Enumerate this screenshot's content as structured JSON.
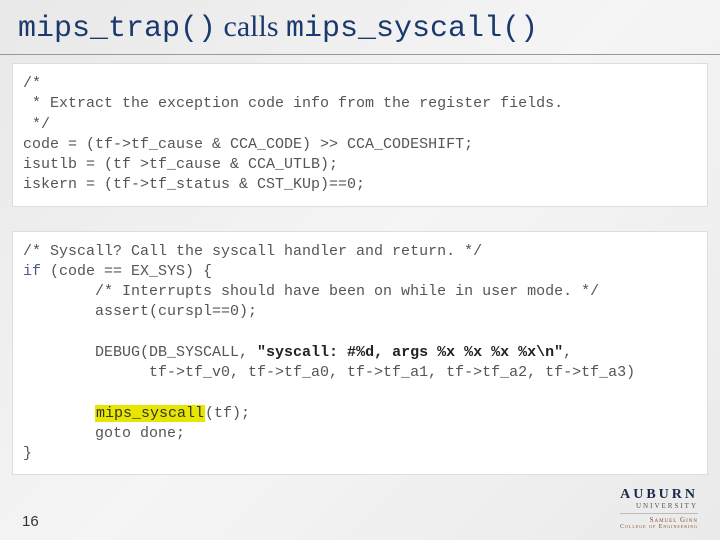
{
  "title": {
    "part1": "mips_trap()",
    "part2": " calls ",
    "part3": "mips_syscall()"
  },
  "code1": {
    "l1": "/*",
    "l2": " * Extract the exception code info from the register fields.",
    "l3": " */",
    "l4": "code = (tf->tf_cause & CCA_CODE) >> CCA_CODESHIFT;",
    "l5": "isutlb = (tf >tf_cause & CCA_UTLB);",
    "l6": "iskern = (tf->tf_status & CST_KUp)==0;"
  },
  "code2": {
    "l1": "/* Syscall? Call the syscall handler and return. */",
    "kw_if": "if",
    "l2b": " (code == EX_SYS) {",
    "l3": "        /* Interrupts should have been on while in user mode. */",
    "l4": "        assert(curspl==0);",
    "l5a": "        DEBUG(DB_SYSCALL, ",
    "l5s": "\"syscall: #%d, args %x %x %x %x\\n\"",
    "l5b": ",",
    "l6": "              tf->tf_v0, tf->tf_a0, tf->tf_a1, tf->tf_a2, tf->tf_a3)",
    "l7h": "mips_syscall",
    "l7b": "(tf);",
    "l8": "        goto done;",
    "l9": "}"
  },
  "footer": {
    "page": "16",
    "logo_main": "AUBURN",
    "logo_sub1": "UNIVERSITY",
    "logo_sub2": "Samuel Ginn",
    "logo_sub3": "College of Engineering"
  }
}
